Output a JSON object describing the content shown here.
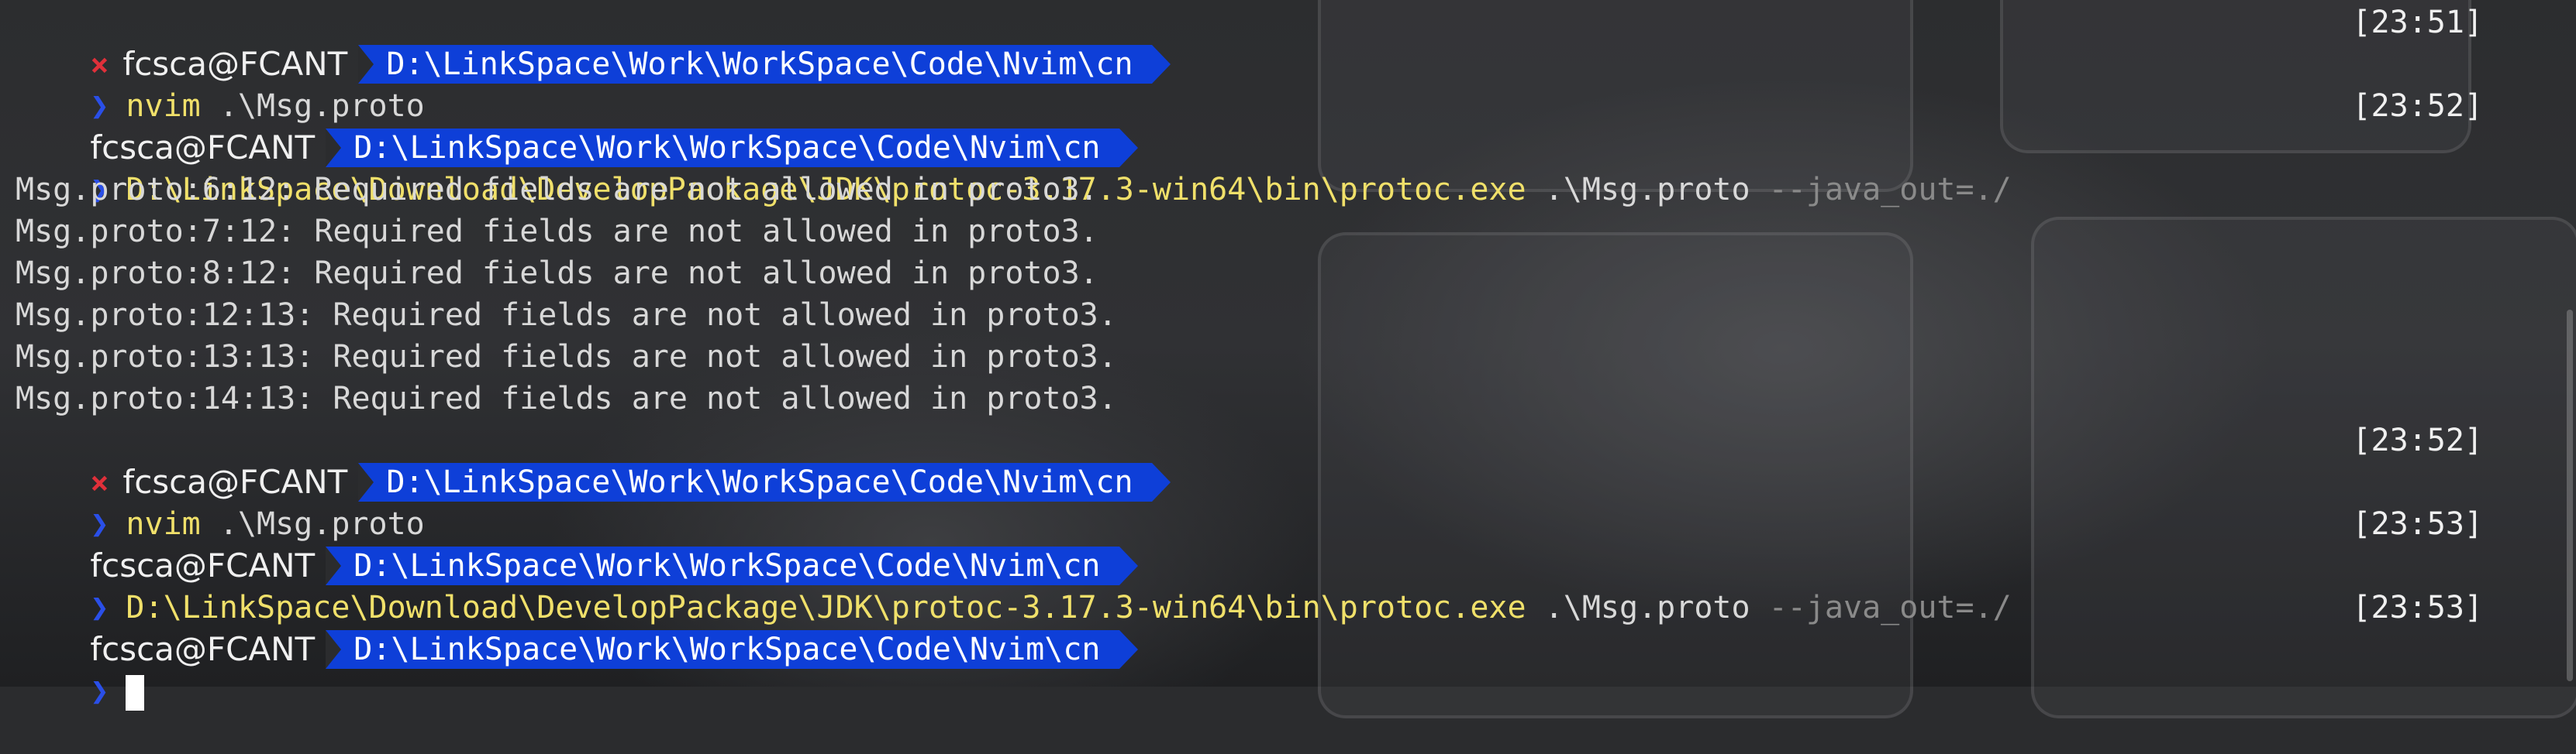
{
  "prompts": [
    {
      "error": true,
      "user": "fcsca@FCANT",
      "path": "D:\\LinkSpace\\Work\\WorkSpace\\Code\\Nvim\\cn",
      "time": "[23:51]"
    },
    {
      "error": false,
      "user": "fcsca@FCANT",
      "path": "D:\\LinkSpace\\Work\\WorkSpace\\Code\\Nvim\\cn",
      "time": "[23:52]"
    },
    {
      "error": true,
      "user": "fcsca@FCANT",
      "path": "D:\\LinkSpace\\Work\\WorkSpace\\Code\\Nvim\\cn",
      "time": "[23:52]"
    },
    {
      "error": false,
      "user": "fcsca@FCANT",
      "path": "D:\\LinkSpace\\Work\\WorkSpace\\Code\\Nvim\\cn",
      "time": "[23:53]"
    },
    {
      "error": false,
      "user": "fcsca@FCANT",
      "path": "D:\\LinkSpace\\Work\\WorkSpace\\Code\\Nvim\\cn",
      "time": "[23:53]"
    }
  ],
  "commands": [
    {
      "cmd": "nvim",
      "args": ".\\Msg.proto",
      "flags": ""
    },
    {
      "cmd": "D:\\LinkSpace\\Download\\DevelopPackage\\JDK\\protoc-3.17.3-win64\\bin\\protoc.exe",
      "args": ".\\Msg.proto",
      "flags": "--java_out=./"
    },
    {
      "cmd": "nvim",
      "args": ".\\Msg.proto",
      "flags": ""
    },
    {
      "cmd": "D:\\LinkSpace\\Download\\DevelopPackage\\JDK\\protoc-3.17.3-win64\\bin\\protoc.exe",
      "args": ".\\Msg.proto",
      "flags": "--java_out=./"
    }
  ],
  "output": [
    "Msg.proto:6:12: Required fields are not allowed in proto3.",
    "Msg.proto:7:12: Required fields are not allowed in proto3.",
    "Msg.proto:8:12: Required fields are not allowed in proto3.",
    "Msg.proto:12:13: Required fields are not allowed in proto3.",
    "Msg.proto:13:13: Required fields are not allowed in proto3.",
    "Msg.proto:14:13: Required fields are not allowed in proto3."
  ],
  "symbols": {
    "error_mark": "×",
    "prompt_char": "❯"
  },
  "colors": {
    "path_bg": "#0e3fd8",
    "error_mark": "#e0303a",
    "prompt_char": "#2a4fe8",
    "command": "#f0e06a",
    "flag": "#8a8a8a"
  },
  "icons": [
    "error-x-icon",
    "prompt-chevron-icon"
  ]
}
